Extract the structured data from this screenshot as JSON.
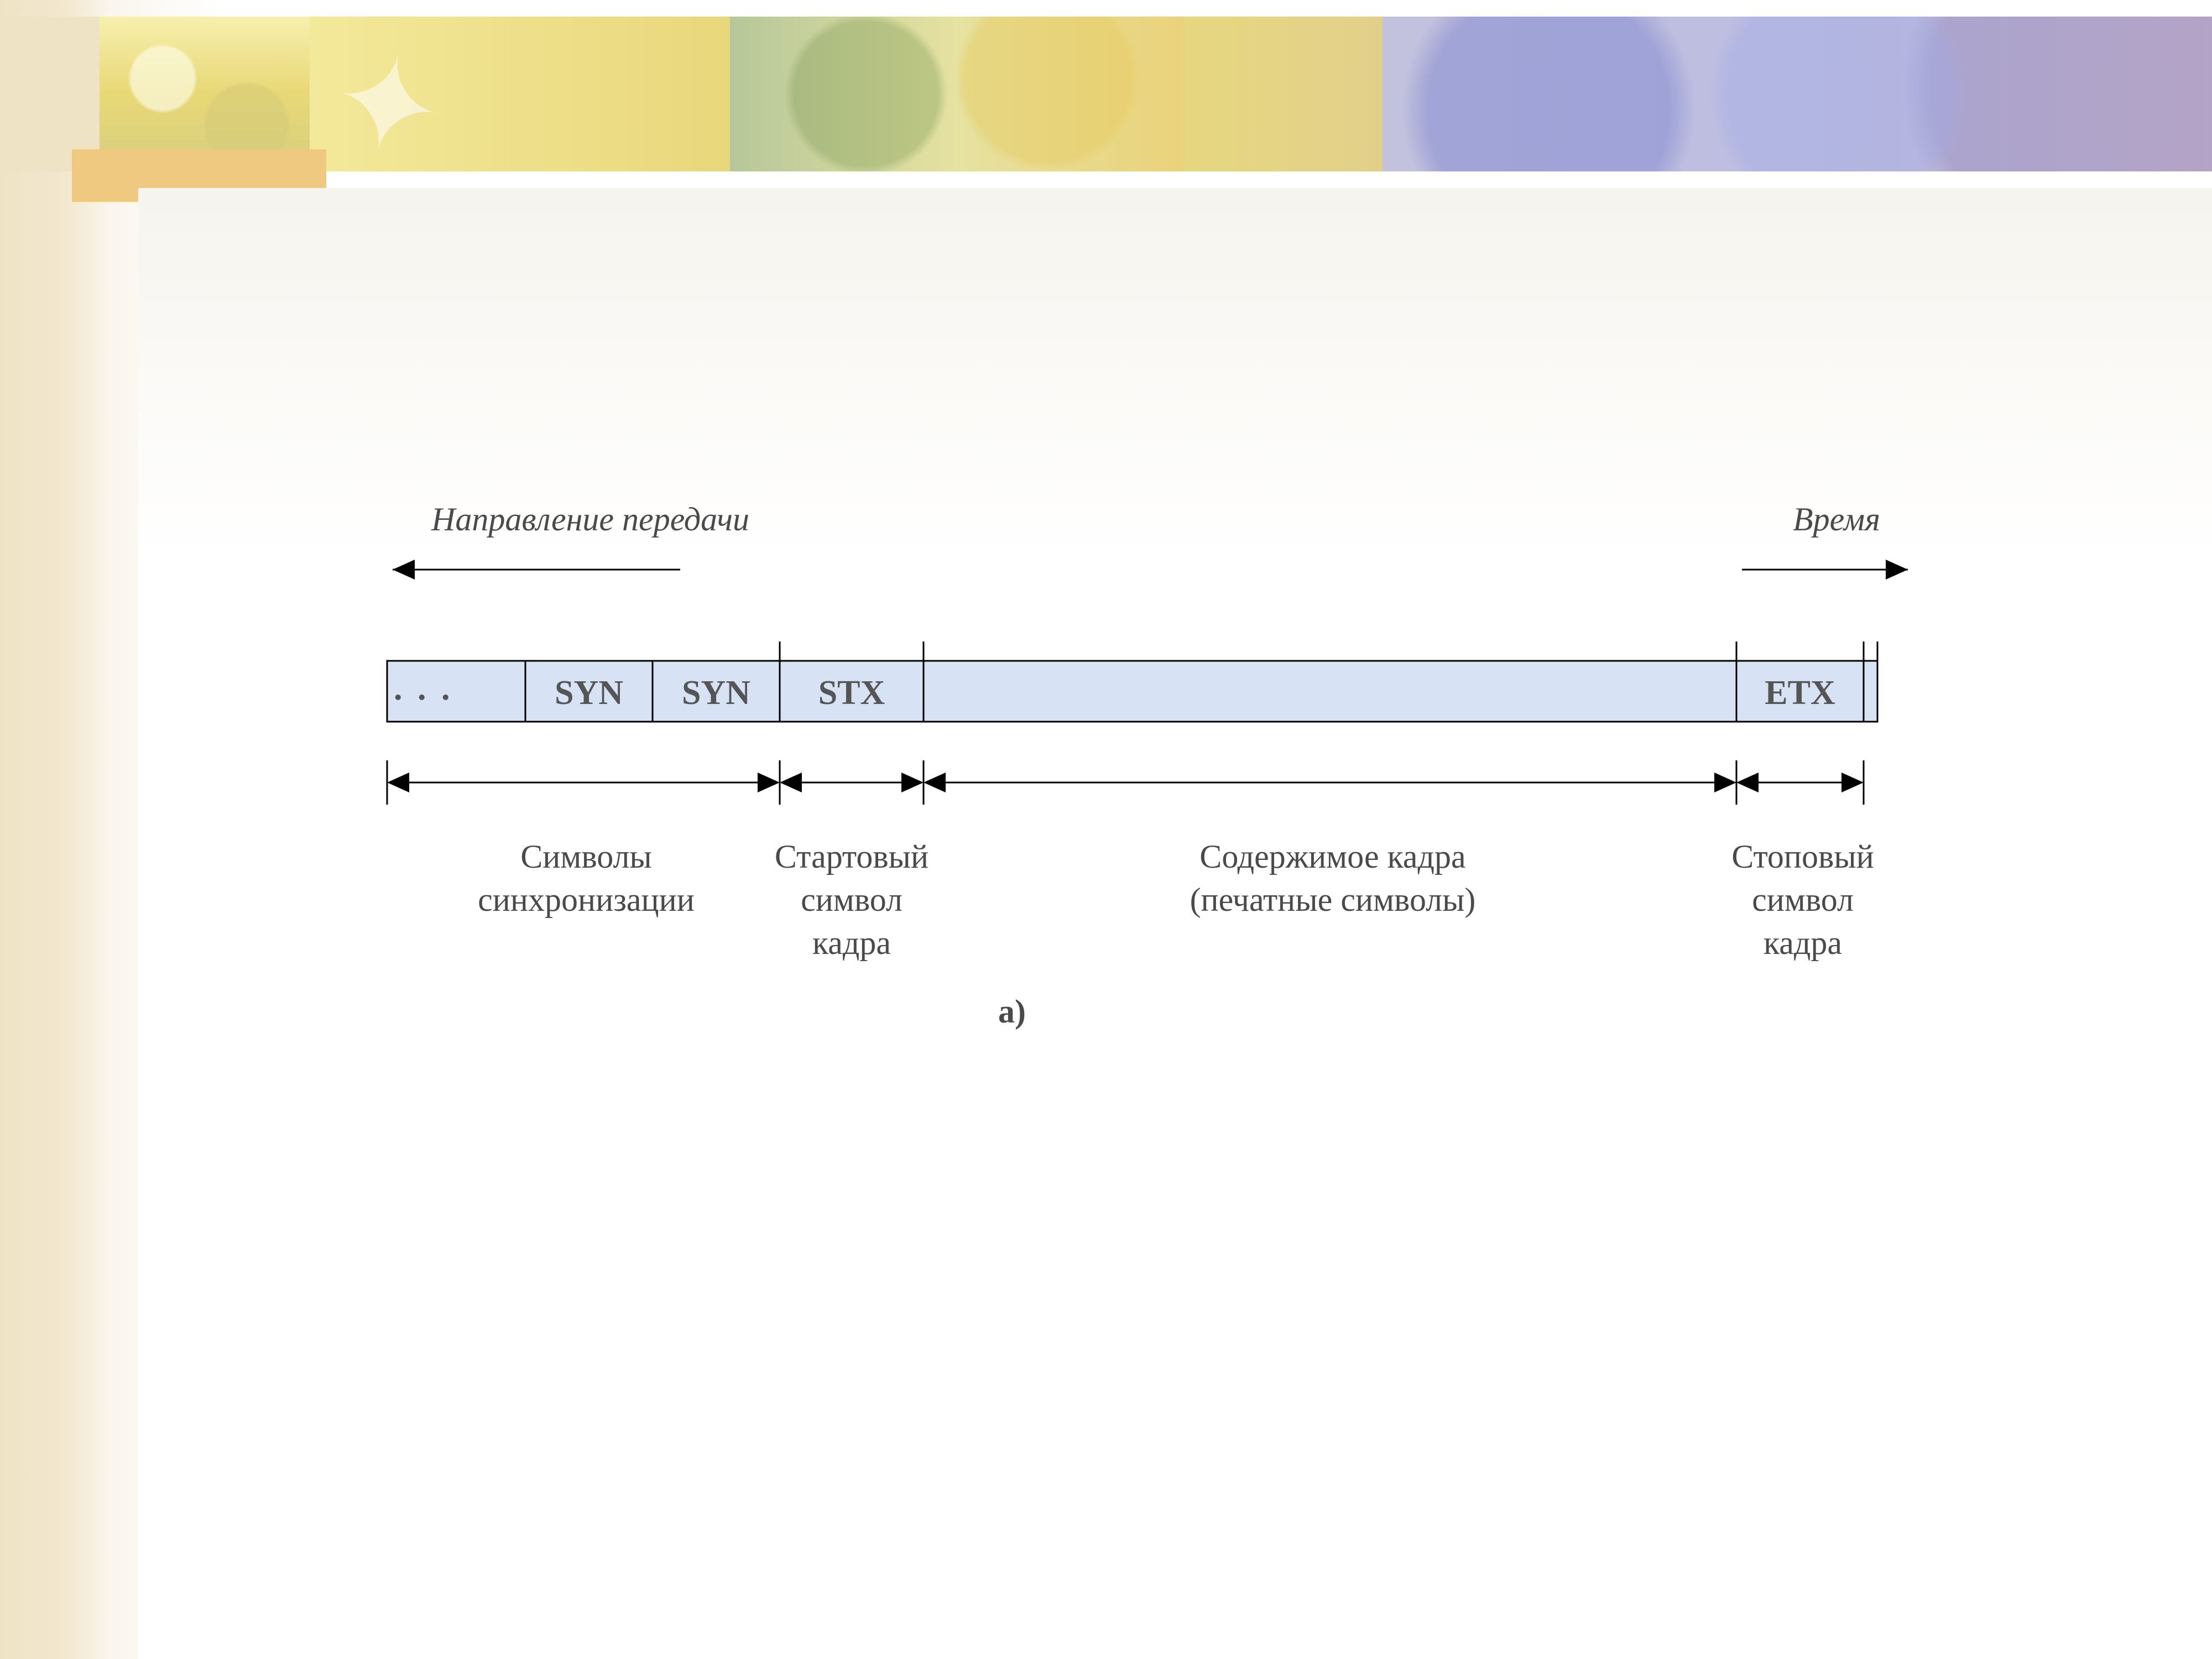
{
  "top_labels": {
    "direction": "Направление передачи",
    "time": "Время"
  },
  "cells": {
    "ellipsis": ". . .",
    "syn1": "SYN",
    "syn2": "SYN",
    "stx": "STX",
    "payload": "",
    "etx": "ETX"
  },
  "brackets": {
    "sync": "Символы\nсинхронизации",
    "start": "Стартовый\nсимвол\nкадра",
    "payload": "Содержимое кадра\n(печатные символы)",
    "stop": "Стоповый\nсимвол\nкадра"
  },
  "figure_label": "a)"
}
